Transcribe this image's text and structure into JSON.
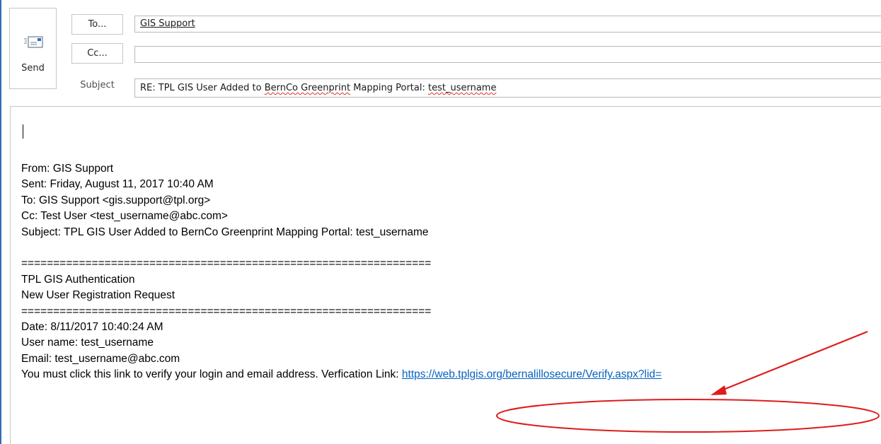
{
  "compose": {
    "send_label": "Send",
    "to_button_label": "To...",
    "cc_button_label": "Cc...",
    "subject_label": "Subject",
    "to_value": "GIS Support",
    "cc_value": "",
    "subject_prefix": "RE: TPL GIS User Added to ",
    "subject_misspelled_1": "BernCo Greenprint",
    "subject_middle": " Mapping Portal: ",
    "subject_misspelled_2": "test_username"
  },
  "body": {
    "from": "From: GIS Support",
    "sent": "Sent: Friday, August 11, 2017 10:40 AM",
    "to": "To: GIS Support <gis.support@tpl.org>",
    "cc": "Cc: Test User <test_username@abc.com>",
    "subject": "Subject: TPL GIS User Added to BernCo Greenprint Mapping Portal: test_username",
    "separator": "================================================================",
    "auth_title": "TPL GIS Authentication",
    "request_title": "New User Registration Request",
    "date": "Date: 8/11/2017 10:40:24 AM",
    "user_name": "User name: test_username",
    "email": "Email: test_username@abc.com",
    "verify_text": "You must click this link to verify your login and email address. Verfication Link: ",
    "verify_link": "https://web.tplgis.org/bernalillosecure/Verify.aspx?lid="
  },
  "icons": {
    "send": "send-envelope-icon"
  },
  "colors": {
    "link": "#0563c1",
    "annotation": "#e01b1b",
    "accent_rule": "#2f6fb5"
  }
}
